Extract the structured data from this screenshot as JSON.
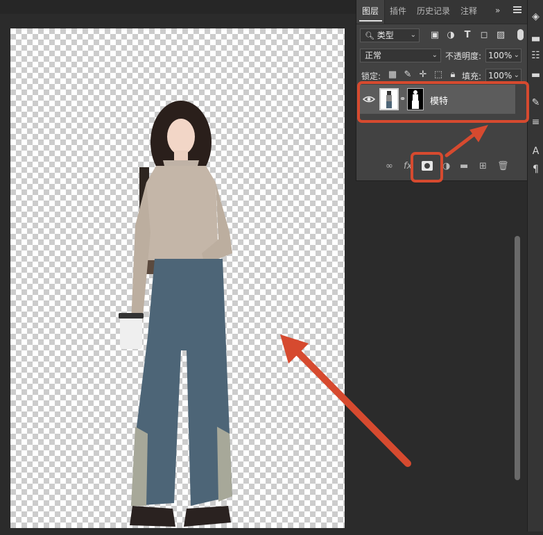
{
  "layers_panel": {
    "tabs": [
      "图层",
      "插件",
      "历史记录",
      "注释"
    ],
    "more_symbol": "»",
    "filter": {
      "label": "类型",
      "icon": "search-icon"
    },
    "blend_mode": "正常",
    "opacity": {
      "label": "不透明度:",
      "value": "100%"
    },
    "lock": {
      "label": "锁定:"
    },
    "fill": {
      "label": "填充:",
      "value": "100%"
    },
    "layer": {
      "name": "模特",
      "visible": true,
      "has_mask": true
    },
    "footer_fx": "fx"
  },
  "toolbar": {
    "text_tool": "A",
    "para_tool": "¶"
  },
  "annotations": {
    "color": "#d64a2f"
  }
}
